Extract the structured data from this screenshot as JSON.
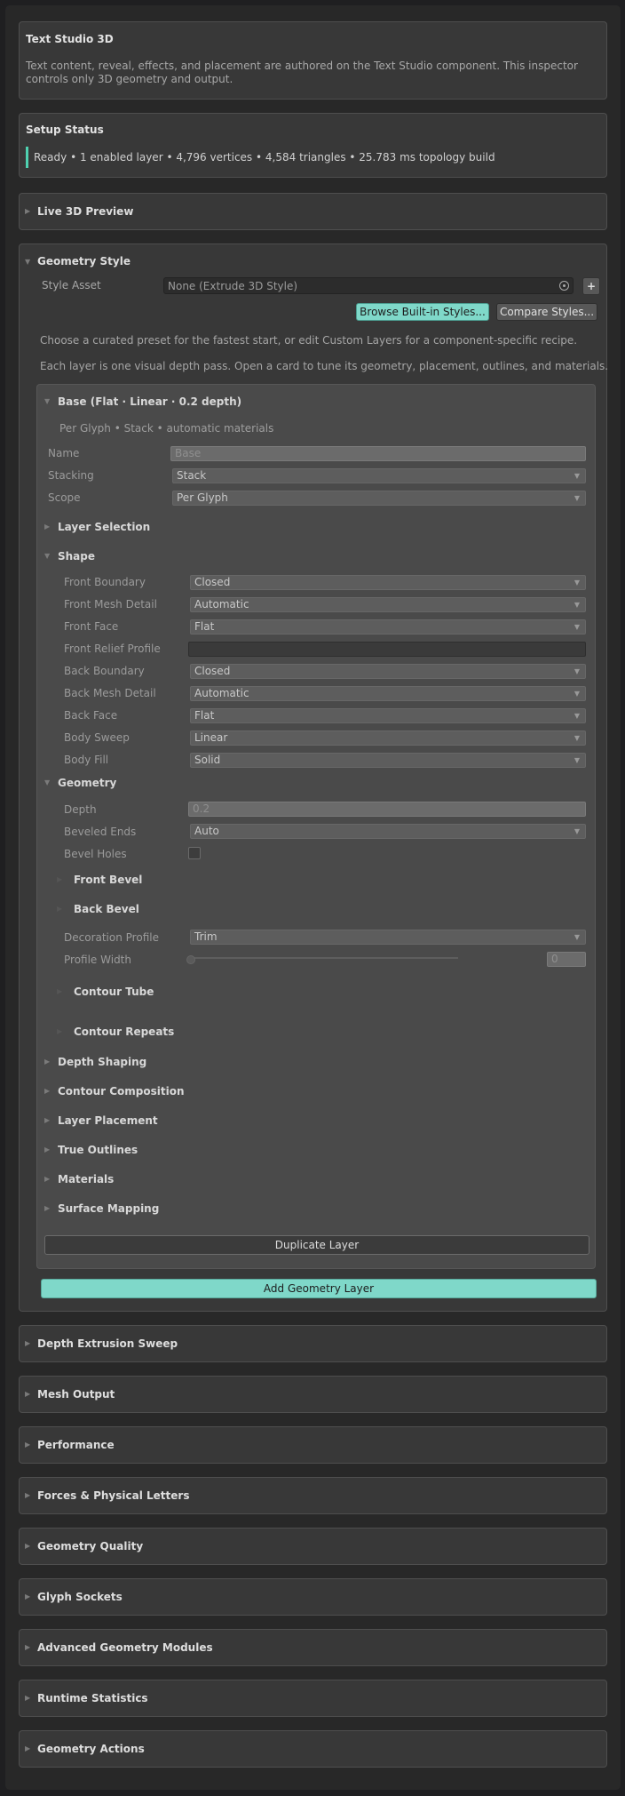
{
  "header": {
    "title": "Text Studio 3D",
    "description": "Text content, reveal, effects, and placement are authored on the Text Studio component. This inspector controls only 3D geometry and output."
  },
  "setup_status": {
    "title": "Setup Status",
    "status_text": "Ready • 1 enabled layer • 4,796 vertices • 4,584 triangles • 25.783 ms topology build",
    "accent_color": "#4fd1b0"
  },
  "live_preview": {
    "title": "Live 3D Preview"
  },
  "geometry_style": {
    "title": "Geometry Style",
    "style_asset_label": "Style Asset",
    "style_asset_value": "None (Extrude 3D Style)",
    "add_button": "+",
    "browse_button": "Browse Built-in Styles...",
    "compare_button": "Compare Styles...",
    "help_1": "Choose a curated preset for the fastest start, or edit Custom Layers for a component-specific recipe.",
    "help_2": "Each layer is one visual depth pass. Open a card to tune its geometry, placement, outlines, and materials.",
    "layer": {
      "title": "Base (Flat · Linear · 0.2 depth)",
      "summary": "Per Glyph • Stack • automatic materials",
      "name_label": "Name",
      "name_value": "Base",
      "stacking_label": "Stacking",
      "stacking_value": "Stack",
      "scope_label": "Scope",
      "scope_value": "Per Glyph",
      "layer_selection": "Layer Selection",
      "shape": {
        "title": "Shape",
        "front_boundary_label": "Front Boundary",
        "front_boundary_value": "Closed",
        "front_mesh_detail_label": "Front Mesh Detail",
        "front_mesh_detail_value": "Automatic",
        "front_face_label": "Front Face",
        "front_face_value": "Flat",
        "front_relief_label": "Front Relief Profile",
        "back_boundary_label": "Back Boundary",
        "back_boundary_value": "Closed",
        "back_mesh_detail_label": "Back Mesh Detail",
        "back_mesh_detail_value": "Automatic",
        "back_face_label": "Back Face",
        "back_face_value": "Flat",
        "body_sweep_label": "Body Sweep",
        "body_sweep_value": "Linear",
        "body_fill_label": "Body Fill",
        "body_fill_value": "Solid"
      },
      "geometry": {
        "title": "Geometry",
        "depth_label": "Depth",
        "depth_value": "0.2",
        "beveled_ends_label": "Beveled Ends",
        "beveled_ends_value": "Auto",
        "bevel_holes_label": "Bevel Holes",
        "front_bevel": "Front Bevel",
        "back_bevel": "Back Bevel",
        "decoration_profile_label": "Decoration Profile",
        "decoration_profile_value": "Trim",
        "profile_width_label": "Profile Width",
        "profile_width_value": "0",
        "contour_tube": "Contour Tube",
        "contour_repeats": "Contour Repeats"
      },
      "sections": [
        "Depth Shaping",
        "Contour Composition",
        "Layer Placement",
        "True Outlines",
        "Materials",
        "Surface Mapping"
      ],
      "duplicate_button": "Duplicate Layer"
    },
    "add_layer_button": "Add Geometry Layer",
    "accent_color": "#7fd8c9"
  },
  "collapsed_panels": [
    "Depth Extrusion Sweep",
    "Mesh Output",
    "Performance",
    "Forces & Physical Letters",
    "Geometry Quality",
    "Glyph Sockets",
    "Advanced Geometry Modules",
    "Runtime Statistics",
    "Geometry Actions"
  ]
}
